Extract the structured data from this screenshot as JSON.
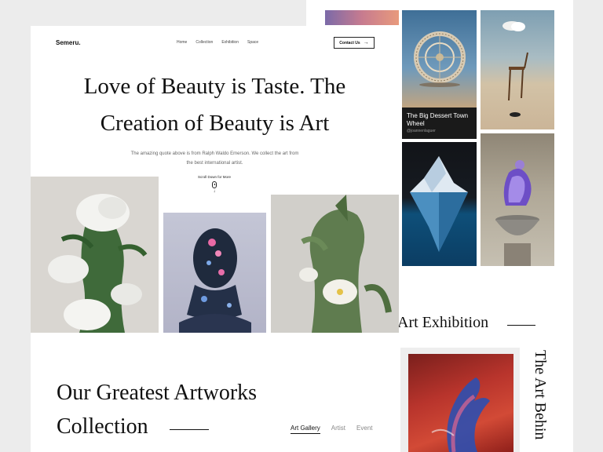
{
  "nav": {
    "logo": "Semeru.",
    "links": [
      "Home",
      "Collection",
      "Exhibition",
      "Space"
    ],
    "contact_label": "Contact Us"
  },
  "hero": {
    "title_line1": "Love of Beauty is Taste. The",
    "title_line2": "Creation of Beauty is Art",
    "quote_line1": "The amazing quote above is from Ralph Waldo Emerson. We collect the art from",
    "quote_line2": "the best international artist.",
    "scroll_label": "Scroll Down for More"
  },
  "collection": {
    "title_line1": "Our Greatest Artworks",
    "title_line2": "Collection",
    "tabs": [
      "Art Gallery",
      "Artist",
      "Event"
    ]
  },
  "gallery": {
    "featured_title_line1": "The Big Dessert Town",
    "featured_title_line2": "Wheel",
    "featured_user": "@joannenlaguer"
  },
  "exhibition": {
    "title": "Art Exhibition",
    "vertical_title": "The Art Behin"
  },
  "colors": {
    "accent": "#111111",
    "page": "#ffffff",
    "background": "#ececec"
  }
}
